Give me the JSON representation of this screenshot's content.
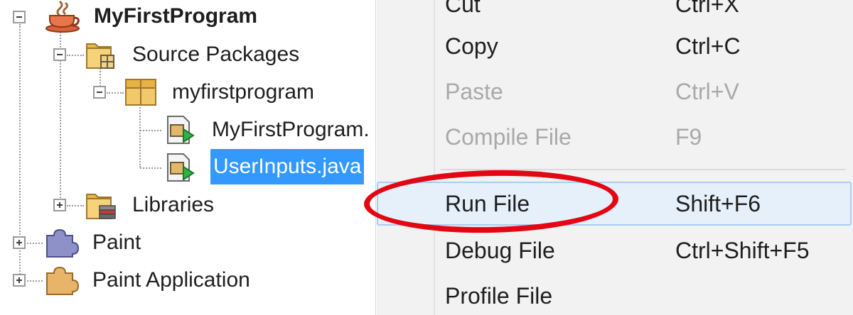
{
  "tree": {
    "project": {
      "label": "MyFirstProgram",
      "icon": "java-cup-icon"
    },
    "source_packages": {
      "label": "Source Packages",
      "icon": "source-folder-icon"
    },
    "package": {
      "label": "myfirstprogram",
      "icon": "package-icon"
    },
    "files": [
      {
        "label": "MyFirstProgram.",
        "icon": "java-file-icon"
      },
      {
        "label": "UserInputs.java",
        "icon": "java-file-icon",
        "selected": true
      }
    ],
    "libraries": {
      "label": "Libraries",
      "icon": "libraries-folder-icon"
    },
    "other_projects": [
      {
        "label": "Paint",
        "icon": "puzzle-icon"
      },
      {
        "label": "Paint Application",
        "icon": "puzzle-icon"
      }
    ]
  },
  "menu": {
    "items": [
      {
        "label": "Cut",
        "shortcut": "Ctrl+X",
        "enabled": true
      },
      {
        "label": "Copy",
        "shortcut": "Ctrl+C",
        "enabled": true
      },
      {
        "label": "Paste",
        "shortcut": "Ctrl+V",
        "enabled": false
      },
      {
        "label": "Compile File",
        "shortcut": "F9",
        "enabled": false
      },
      {
        "label": "Run File",
        "shortcut": "Shift+F6",
        "enabled": true,
        "highlighted": true
      },
      {
        "label": "Debug File",
        "shortcut": "Ctrl+Shift+F5",
        "enabled": true
      },
      {
        "label": "Profile File",
        "shortcut": "",
        "enabled": true
      }
    ]
  },
  "colors": {
    "selection": "#3399ff",
    "annotation": "#e30613",
    "menu_background": "#f2f2f2",
    "disabled_text": "#a9a9a9",
    "hover_border": "#a8cdf3"
  }
}
